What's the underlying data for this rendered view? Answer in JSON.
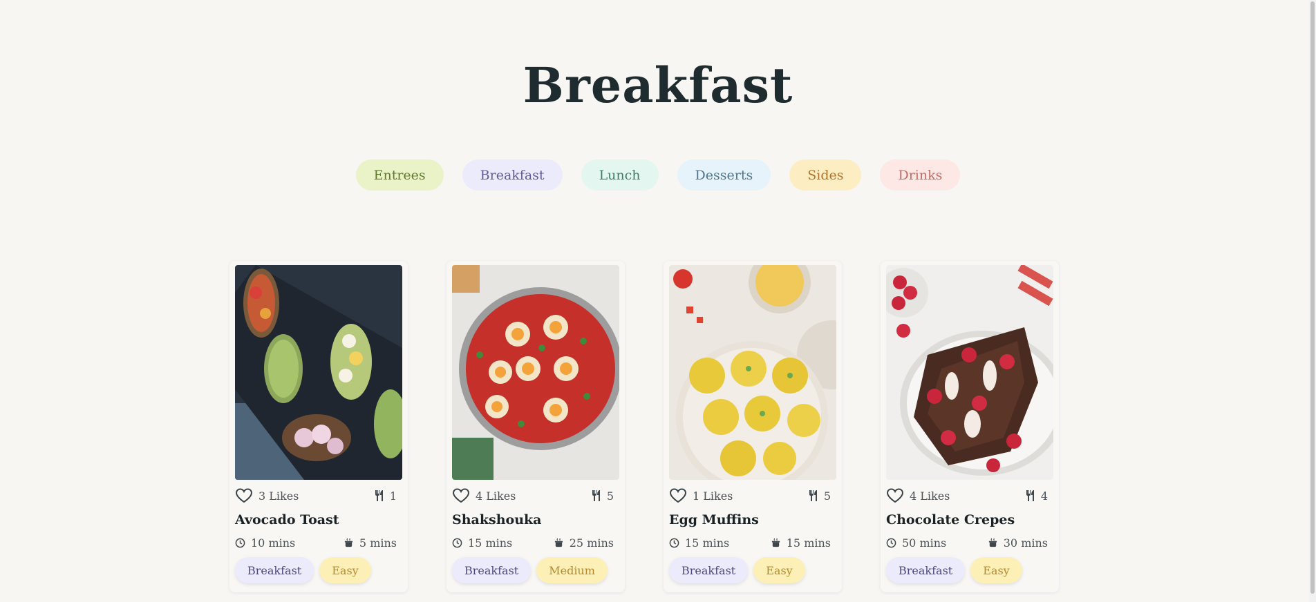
{
  "page": {
    "title": "Breakfast"
  },
  "categories": [
    {
      "label": "Entrees"
    },
    {
      "label": "Breakfast"
    },
    {
      "label": "Lunch"
    },
    {
      "label": "Desserts"
    },
    {
      "label": "Sides"
    },
    {
      "label": "Drinks"
    }
  ],
  "recipes": [
    {
      "name": "Avocado Toast",
      "likes": "3 Likes",
      "servings": "1",
      "prep": "10 mins",
      "cook": "5 mins",
      "category": "Breakfast",
      "difficulty": "Easy"
    },
    {
      "name": "Shakshouka",
      "likes": "4 Likes",
      "servings": "5",
      "prep": "15 mins",
      "cook": "25 mins",
      "category": "Breakfast",
      "difficulty": "Medium"
    },
    {
      "name": "Egg Muffins",
      "likes": "1 Likes",
      "servings": "5",
      "prep": "15 mins",
      "cook": "15 mins",
      "category": "Breakfast",
      "difficulty": "Easy"
    },
    {
      "name": "Chocolate Crepes",
      "likes": "4 Likes",
      "servings": "4",
      "prep": "50 mins",
      "cook": "30 mins",
      "category": "Breakfast",
      "difficulty": "Easy"
    }
  ],
  "icons": {
    "like": "heart-icon",
    "servings": "utensils-icon",
    "prep": "clock-icon",
    "cook": "cooking-pot-icon"
  },
  "colors": {
    "background": "#f8f6f3",
    "title": "#1e2b2f",
    "chip_entrees": "#eaf3c8",
    "chip_breakfast": "#ecebfb",
    "chip_lunch": "#e3f6ef",
    "chip_desserts": "#e6f3fb",
    "chip_sides": "#fdedc3",
    "chip_drinks": "#fde8e6",
    "tag_difficulty": "#fdf0b6"
  }
}
